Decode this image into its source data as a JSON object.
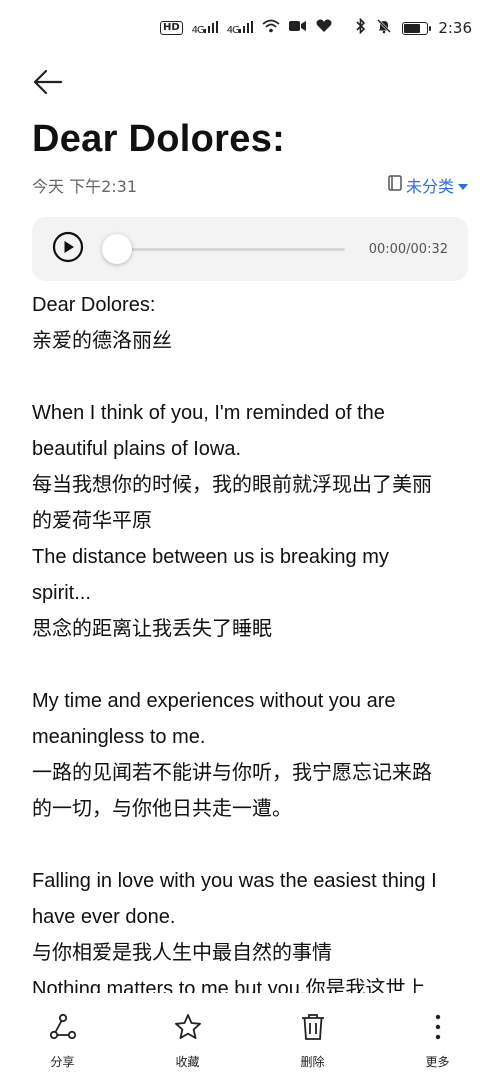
{
  "status_bar": {
    "hd_label": "HD",
    "signal_1": "4G",
    "signal_2": "4G",
    "time": "2:36",
    "battery_level": 0.75
  },
  "header": {
    "back_icon": "arrow-left-icon",
    "title": "Dear Dolores:",
    "timestamp": "今天 下午2:31",
    "category_label": "未分类",
    "category_icon": "notebook-icon"
  },
  "audio": {
    "time_readout": "00:00/00:32",
    "progress": 0.0
  },
  "body": {
    "lines": [
      "Dear Dolores:",
      "亲爱的德洛丽丝",
      "",
      "When I think of you, I'm reminded of the",
      "beautiful plains of Iowa.",
      "每当我想你的时候，我的眼前就浮现出了美丽",
      "的爱荷华平原",
      "The distance between us is breaking my",
      "spirit...",
      "思念的距离让我丢失了睡眠",
      "",
      "My time and experiences without you are",
      "meaningless to me.",
      "一路的见闻若不能讲与你听，我宁愿忘记来路",
      "的一切，与你他日共走一遭。",
      "",
      "Falling in love with you was the easiest thing I",
      "have ever done.",
      "与你相爱是我人生中最自然的事情",
      "Nothing matters to me but you.你是我这世上"
    ]
  },
  "toolbar": {
    "share_label": "分享",
    "favorite_label": "收藏",
    "delete_label": "删除",
    "more_label": "更多"
  },
  "colors": {
    "accent": "#2f6fd6",
    "text": "#111111",
    "muted": "#666666",
    "player_bg": "#f3f3f3"
  }
}
